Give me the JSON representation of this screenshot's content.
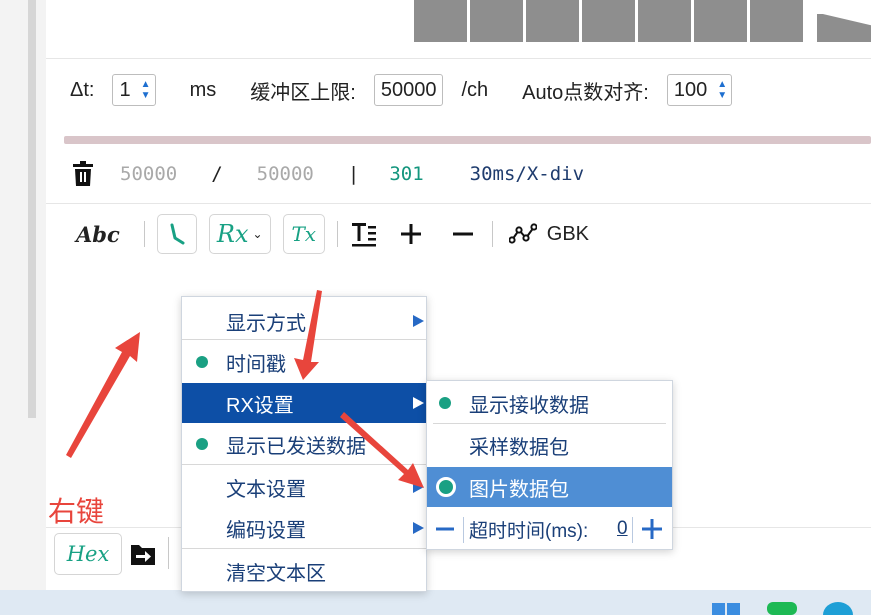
{
  "settings": {
    "dt_label": "Δt:",
    "dt_value": "1",
    "dt_unit": "ms",
    "buffer_label": "缓冲区上限:",
    "buffer_value": "50000",
    "buffer_unit": "/ch",
    "auto_label": "Auto点数对齐:",
    "auto_value": "100"
  },
  "stats": {
    "count_current": "50000",
    "slash": "/",
    "count_max": "50000",
    "pipe": "|",
    "points": "301",
    "timebase": "30ms/X-div"
  },
  "toolbar": {
    "abc_label": "Abc",
    "rx_label": "Rx",
    "tx_label": "Tx",
    "encoding": "GBK"
  },
  "context_menu": {
    "items": [
      {
        "label": "显示方式"
      },
      {
        "label": "时间戳"
      },
      {
        "label": "RX设置"
      },
      {
        "label": "显示已发送数据"
      },
      {
        "label": "文本设置"
      },
      {
        "label": "编码设置"
      },
      {
        "label": "清空文本区"
      }
    ]
  },
  "submenu": {
    "items": [
      {
        "label": "显示接收数据"
      },
      {
        "label": "采样数据包"
      },
      {
        "label": "图片数据包"
      }
    ],
    "timeout_label": "超时时间(ms):",
    "timeout_value": "0"
  },
  "bottom": {
    "hex_label": "Hex"
  },
  "annotation": {
    "right_click": "右键"
  },
  "colors": {
    "accent_blue": "#0d4fa6",
    "highlight_blue": "#4f8ed4",
    "teal": "#18a184",
    "arrow_red": "#e8453c"
  }
}
